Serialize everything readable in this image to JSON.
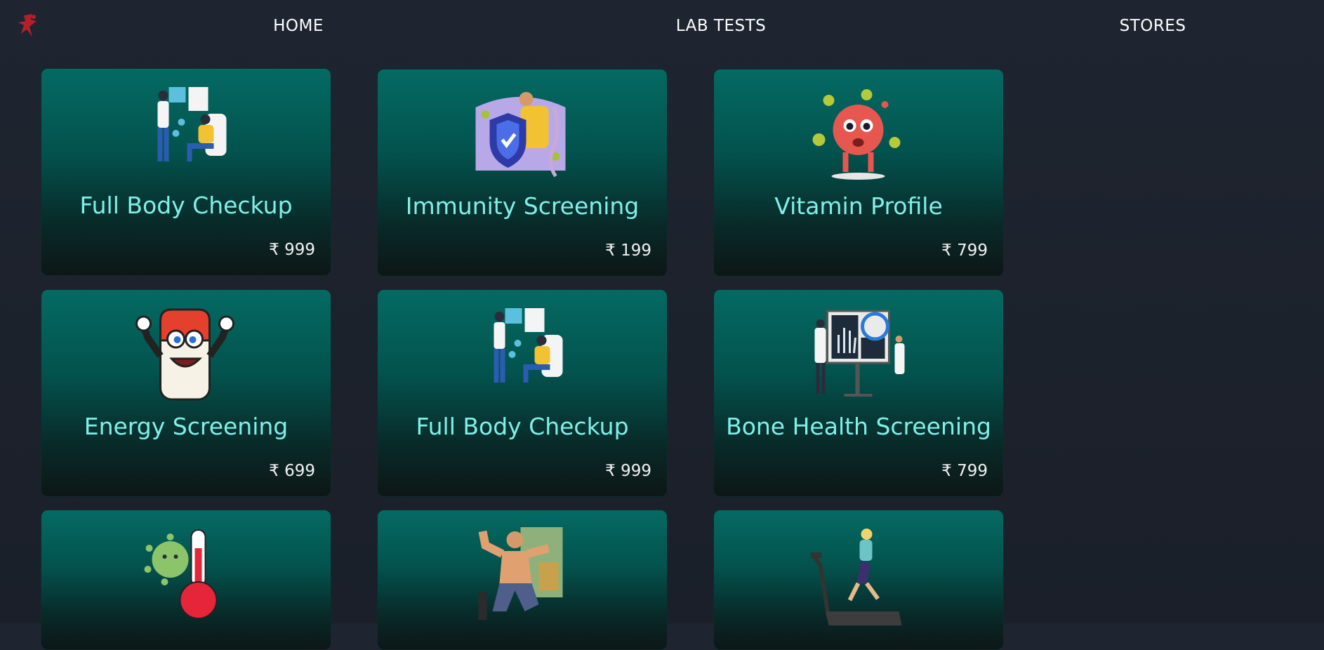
{
  "nav": {
    "links": [
      {
        "label": "HOME"
      },
      {
        "label": "LAB TESTS"
      },
      {
        "label": "STORES"
      }
    ]
  },
  "colors": {
    "background": "#1f2530",
    "card_top": "#046a63",
    "card_bottom": "#0e1616",
    "title": "#7ff0e8",
    "price": "#f2f2f2",
    "logo": "#b3202a"
  },
  "cards": [
    {
      "title": "Full Body Checkup",
      "price": "₹ 999",
      "icon": "doctor-patient-icon"
    },
    {
      "title": "Immunity Screening",
      "price": "₹ 199",
      "icon": "immunity-shield-icon"
    },
    {
      "title": "Vitamin Profile",
      "price": "₹ 799",
      "icon": "vitamin-character-icon"
    },
    {
      "title": "Energy Screening",
      "price": "₹ 699",
      "icon": "energy-battery-icon"
    },
    {
      "title": "Full Body Checkup",
      "price": "₹ 999",
      "icon": "doctor-patient-icon"
    },
    {
      "title": "Bone Health Screening",
      "price": "₹ 799",
      "icon": "xray-doctors-icon"
    },
    {
      "icon": "virus-thermometer-icon"
    },
    {
      "icon": "muscle-man-icon"
    },
    {
      "icon": "treadmill-runner-icon"
    }
  ]
}
